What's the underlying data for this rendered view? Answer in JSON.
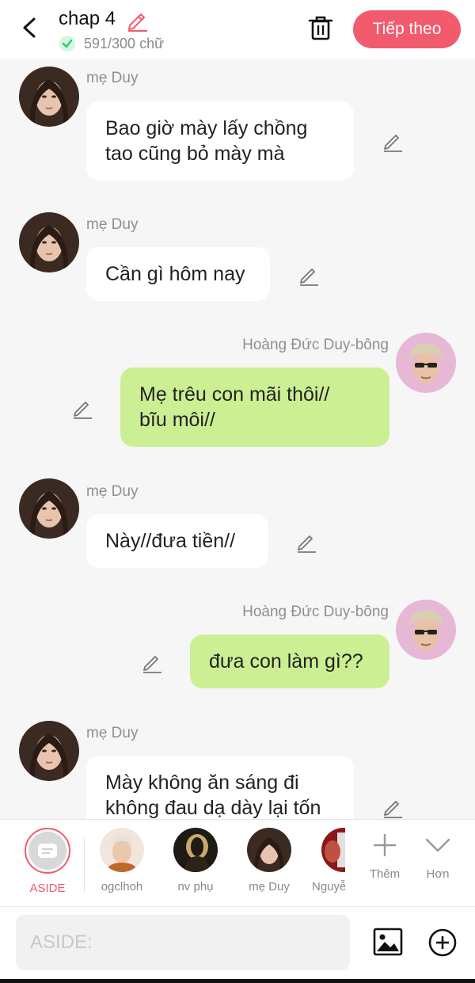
{
  "header": {
    "title": "chap 4",
    "word_count": "591/300 chữ",
    "next_label": "Tiếp theo"
  },
  "messages": [
    {
      "side": "left",
      "name": "mẹ Duy",
      "text_lines": [
        "Bao giờ mày lấy chồng",
        "tao cũng bỏ mày mà"
      ]
    },
    {
      "side": "left",
      "name": "mẹ Duy",
      "text_lines": [
        "Cần gì hôm nay"
      ]
    },
    {
      "side": "right",
      "name": "Hoàng Đức Duy-bông",
      "text_lines": [
        "Mẹ trêu con mãi thôi//",
        "bĩu môi//"
      ]
    },
    {
      "side": "left",
      "name": "mẹ Duy",
      "text_lines": [
        "Này//đưa tiền//"
      ]
    },
    {
      "side": "right",
      "name": "Hoàng Đức Duy-bông",
      "text_lines": [
        "đưa con làm gì??"
      ]
    },
    {
      "side": "left",
      "name": "mẹ Duy",
      "text_lines": [
        "Mày không ăn sáng đi",
        "không đau dạ dày lại tốn"
      ]
    }
  ],
  "characters": [
    {
      "label": "ASIDE",
      "active": true
    },
    {
      "label": "ogclhoh"
    },
    {
      "label": "nv phụ"
    },
    {
      "label": "mẹ Duy"
    },
    {
      "label": "Nguyễ"
    }
  ],
  "tools": {
    "add_label": "Thêm",
    "more_label": "Hơn"
  },
  "composer": {
    "placeholder": "ASIDE:"
  },
  "colors": {
    "accent": "#f25a6e",
    "right_bubble": "#ccef93",
    "left_bubble": "#ffffff",
    "check": "#2ecc71"
  }
}
